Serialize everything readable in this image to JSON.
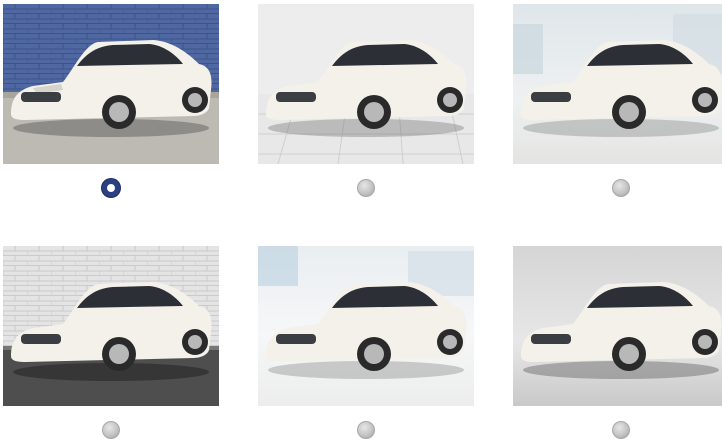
{
  "options": [
    {
      "background": "blue-brick-wall",
      "selected": true
    },
    {
      "background": "white-tile-studio",
      "selected": false
    },
    {
      "background": "blurred-showroom",
      "selected": false
    },
    {
      "background": "white-brick-garage",
      "selected": false
    },
    {
      "background": "bright-dealership",
      "selected": false
    },
    {
      "background": "grey-studio",
      "selected": false
    }
  ],
  "colors": {
    "selected_radio": "#2b3f83",
    "unselected_radio": "#c4c4c4",
    "car_body": "#f3f1ea"
  }
}
